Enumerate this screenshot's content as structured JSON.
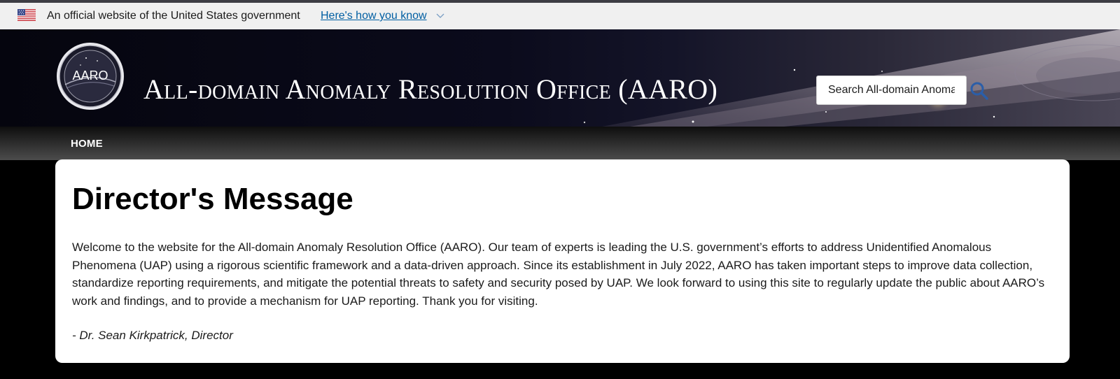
{
  "gov_banner": {
    "flag_icon": "us-flag-icon",
    "text": "An official website of the United States government",
    "link_text": "Here's how you know",
    "link_icon": "chevron-down-icon",
    "background": "#f0f0f0",
    "link_color": "#005ea2"
  },
  "header": {
    "logo_text": "AARO",
    "title": "All-domain Anomaly Resolution Office (AARO)",
    "search": {
      "placeholder": "Search All-domain Anomaly Resolution Office",
      "icon": "search-icon",
      "icon_color": "#2b5ea8"
    }
  },
  "nav": {
    "items": [
      {
        "label": "HOME"
      }
    ]
  },
  "main": {
    "title": "Director's Message",
    "body": "Welcome to the website for the All-domain Anomaly Resolution Office (AARO).  Our team of experts is leading the U.S. government’s efforts to address Unidentified Anomalous Phenomena (UAP) using a rigorous scientific framework and a data-driven approach.  Since its establishment in July 2022, AARO has taken important steps to improve data collection, standardize reporting requirements, and mitigate the potential threats to safety and security posed by UAP.  We look forward to using this site to regularly update the public about AARO’s work and findings, and to provide a mechanism for UAP reporting. Thank you for visiting.",
    "signature": "- Dr. Sean Kirkpatrick, Director"
  }
}
